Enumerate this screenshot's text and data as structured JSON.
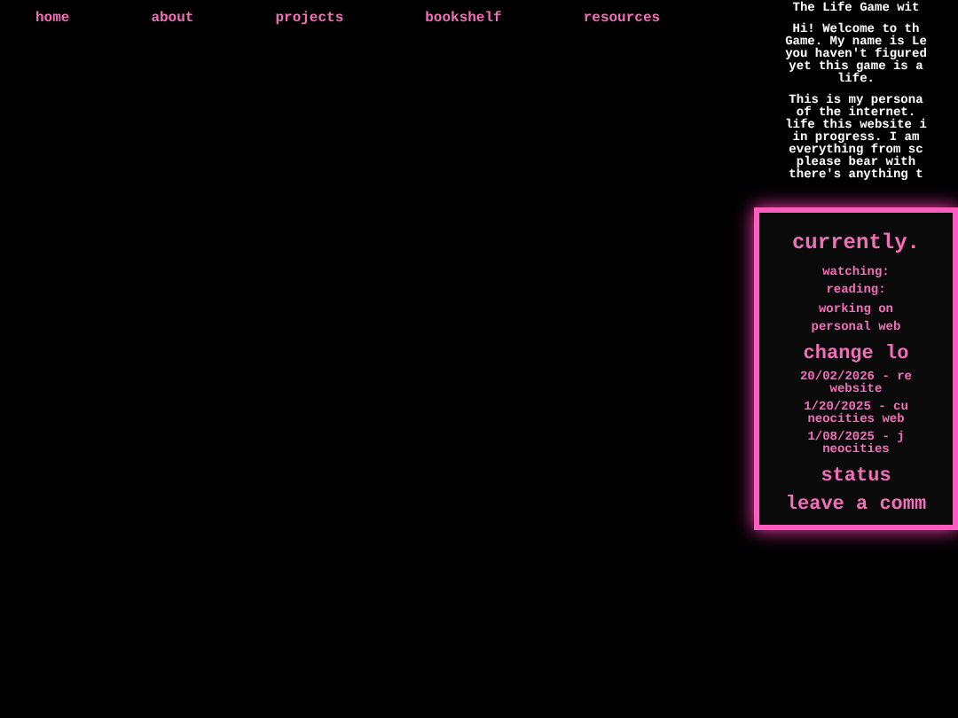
{
  "nav": [
    "home",
    "about",
    "projects",
    "bookshelf",
    "resources"
  ],
  "intro": {
    "title": "The Life Game wit",
    "paragraphs": [
      [
        "Hi! Welcome to th",
        "Game. My name is Le",
        "you haven't figured",
        "yet this game is a",
        "life."
      ],
      [
        "This is my persona",
        "of the internet.",
        "life this website i",
        "in progress. I am",
        "everything from sc",
        "please bear with",
        "there's anything t"
      ]
    ]
  },
  "currently": {
    "title": "currently.",
    "lines": [
      "watching:",
      "reading:",
      "working on",
      "personal web"
    ]
  },
  "changelog": {
    "title": "change lo",
    "entries": [
      [
        "20/02/2026 - re",
        "website"
      ],
      [
        "1/20/2025 - cu",
        "neocities web"
      ],
      [
        "1/08/2025 - j",
        "neocities"
      ]
    ]
  },
  "status": {
    "title": "status"
  },
  "comment": {
    "label": "leave a comm"
  }
}
